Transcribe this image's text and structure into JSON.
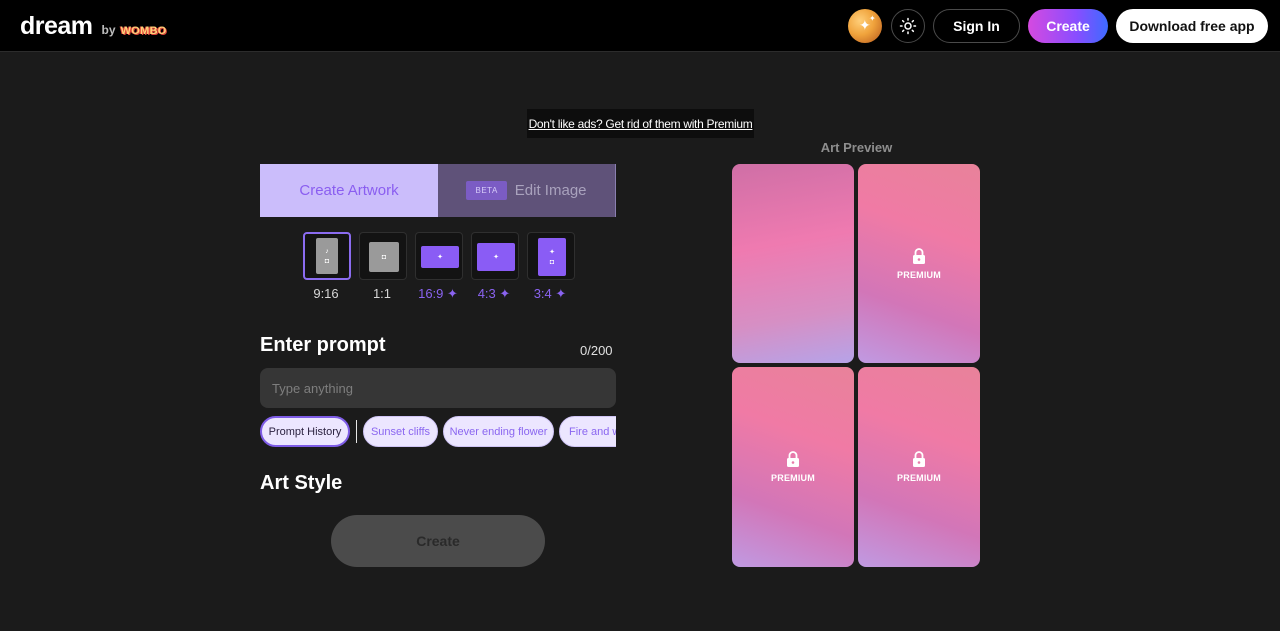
{
  "header": {
    "logo_main": "dream",
    "logo_by": "by",
    "logo_wombo": "WOMBO",
    "sign_in": "Sign In",
    "create": "Create",
    "download": "Download free app"
  },
  "ad": {
    "text": "Don't like ads? Get rid of them with Premium"
  },
  "tabs": {
    "create_artwork": "Create Artwork",
    "beta": "BETA",
    "edit_image": "Edit Image"
  },
  "ratios": [
    {
      "label": "9:16",
      "selected": true,
      "premium": false
    },
    {
      "label": "1:1",
      "selected": false,
      "premium": false
    },
    {
      "label": "16:9 ✦",
      "selected": false,
      "premium": true
    },
    {
      "label": "4:3 ✦",
      "selected": false,
      "premium": true
    },
    {
      "label": "3:4 ✦",
      "selected": false,
      "premium": true
    }
  ],
  "prompt": {
    "heading": "Enter prompt",
    "counter": "0/200",
    "placeholder": "Type anything",
    "value": ""
  },
  "chips": {
    "history": "Prompt History",
    "suggestions": [
      "Sunset cliffs",
      "Never ending flower",
      "Fire and w"
    ]
  },
  "art_style": {
    "heading": "Art Style"
  },
  "create_button": "Create",
  "preview": {
    "title": "Art Preview",
    "cards": [
      {
        "premium": false,
        "label": ""
      },
      {
        "premium": true,
        "label": "PREMIUM"
      },
      {
        "premium": true,
        "label": "PREMIUM"
      },
      {
        "premium": true,
        "label": "PREMIUM"
      }
    ]
  },
  "colors": {
    "accent": "#8a5cf5",
    "tab_active_bg": "#cbbdfb",
    "tab_inactive_bg": "#5f5279"
  }
}
